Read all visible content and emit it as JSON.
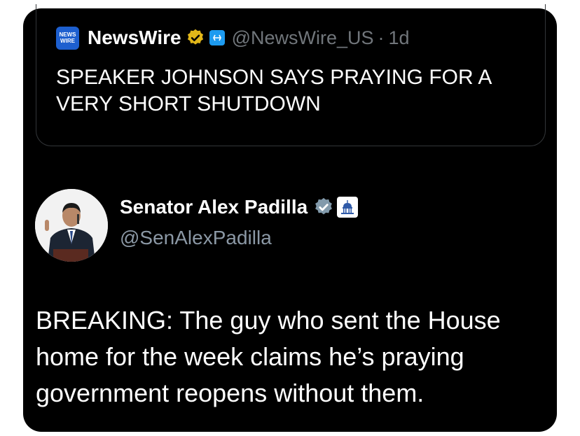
{
  "quoted_post": {
    "logo_text_line1": "NEWS",
    "logo_text_line2": "WIRE",
    "display_name": "NewsWire",
    "handle": "@NewsWire_US",
    "separator": "·",
    "time": "1d",
    "text": "SPEAKER JOHNSON SAYS PRAYING FOR A VERY SHORT SHUTDOWN",
    "verified_badge": "gold-verified-badge-icon",
    "affiliate_badge": "affiliate-badge-icon"
  },
  "post": {
    "display_name": "Senator Alex Padilla",
    "handle": "@SenAlexPadilla",
    "verified_badge": "gray-verified-badge-icon",
    "government_badge": "capitol-building-icon",
    "text": "BREAKING: The guy who sent the House home for the week claims he’s praying government reopens without them."
  },
  "colors": {
    "card_background": "#000000",
    "text_primary": "#ffffff",
    "text_secondary": "#71767b",
    "gold_badge": "#e2b719",
    "gray_badge": "#829aab",
    "accent_blue": "#1d9bf0"
  }
}
